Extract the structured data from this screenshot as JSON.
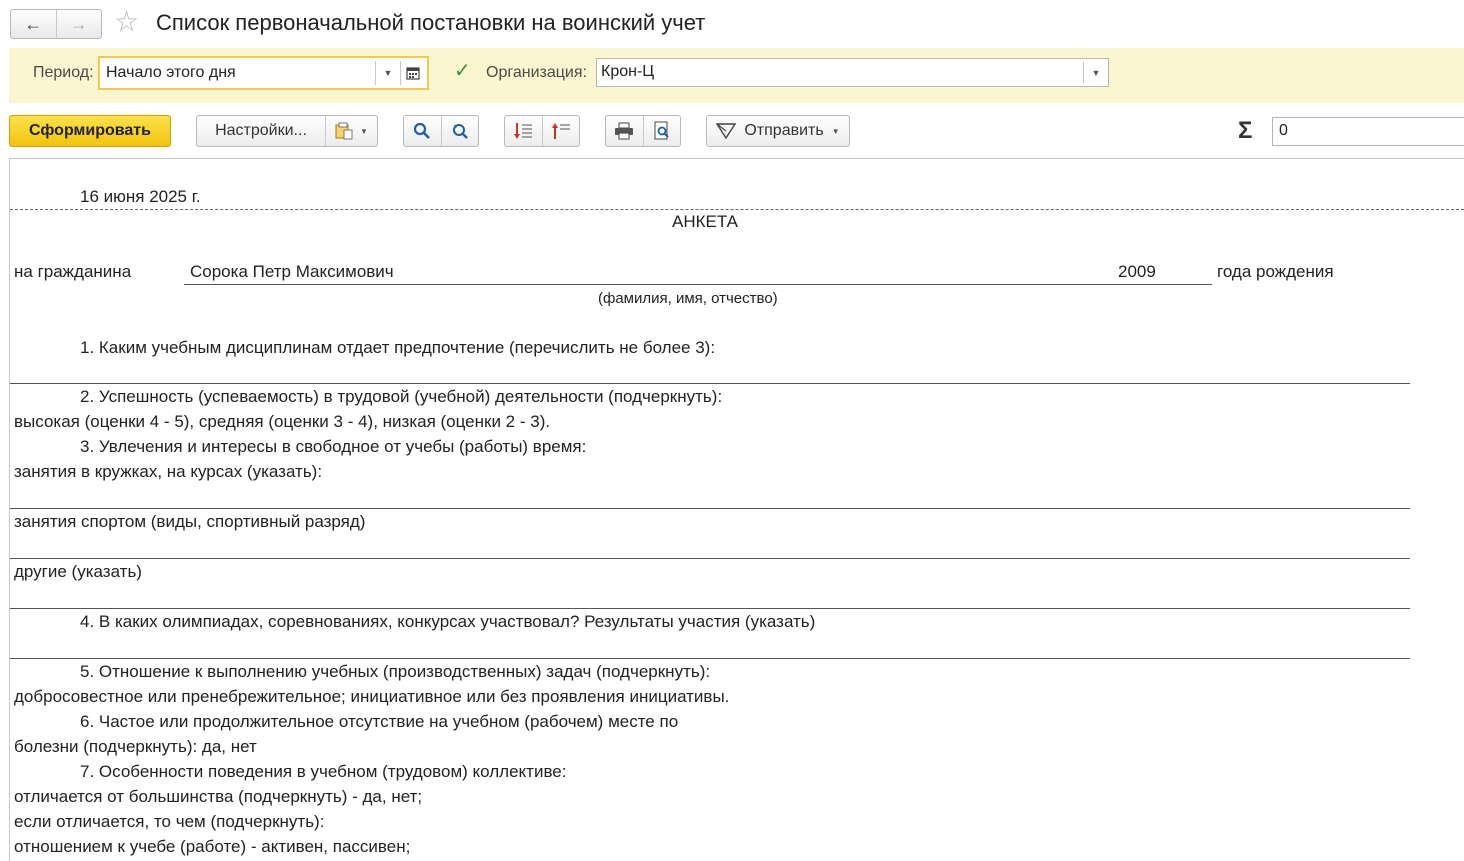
{
  "window": {
    "title": "Список первоначальной постановки на воинский учет",
    "back_icon": "←",
    "forward_icon": "→",
    "favorite_icon": "☆"
  },
  "filters": {
    "period_label": "Период:",
    "period_value": "Начало этого дня",
    "org_checked": true,
    "org_label": "Организация:",
    "org_value": "Крон-Ц"
  },
  "toolbar": {
    "generate_label": "Сформировать",
    "settings_label": "Настройки...",
    "send_label": "Отправить",
    "sum_value": "0"
  },
  "report": {
    "date": "16 июня 2025 г.",
    "heading": "АНКЕТА",
    "citizen_prefix": "на гражданина",
    "citizen_name": "Сорока Петр Максимович",
    "birth_year": "2009",
    "birth_suffix": "года рождения",
    "name_caption": "(фамилия, имя, отчество)",
    "q1": "1.  Каким учебным дисциплинам отдает предпочтение (перечислить не более 3):",
    "q2": "2.   Успешность (успеваемость) в трудовой (учебной) деятельности (подчеркнуть):",
    "q2_options": "высокая (оценки 4 - 5), средняя (оценки 3 - 4), низкая (оценки 2 - 3).",
    "q3": "3. Увлечения и интересы в свободное от учебы (работы) время:",
    "q3_a": "занятия в кружках, на курсах (указать):",
    "q3_b": "занятия спортом (виды, спортивный разряд)",
    "q3_c": "другие (указать)",
    "q4": "4.  В каких олимпиадах, соревнованиях, конкурсах участвовал? Результаты участия (указать)",
    "q5": "5.    Отношение к выполнению учебных (производственных) задач (подчеркнуть):",
    "q5_options": "добросовестное или пренебрежительное; инициативное или без проявления инициативы.",
    "q6": "6.  Частое или продолжительное отсутствие на учебном (рабочем) месте по",
    "q6_cont": "болезни (подчеркнуть): да, нет",
    "q7": "7. Особенности поведения в учебном (трудовом) коллективе:",
    "q7_a": "отличается от большинства (подчеркнуть) - да, нет;",
    "q7_b": "если отличается, то чем (подчеркнуть):",
    "q7_c": "отношением к учебе (работе) - активен, пассивен;"
  }
}
